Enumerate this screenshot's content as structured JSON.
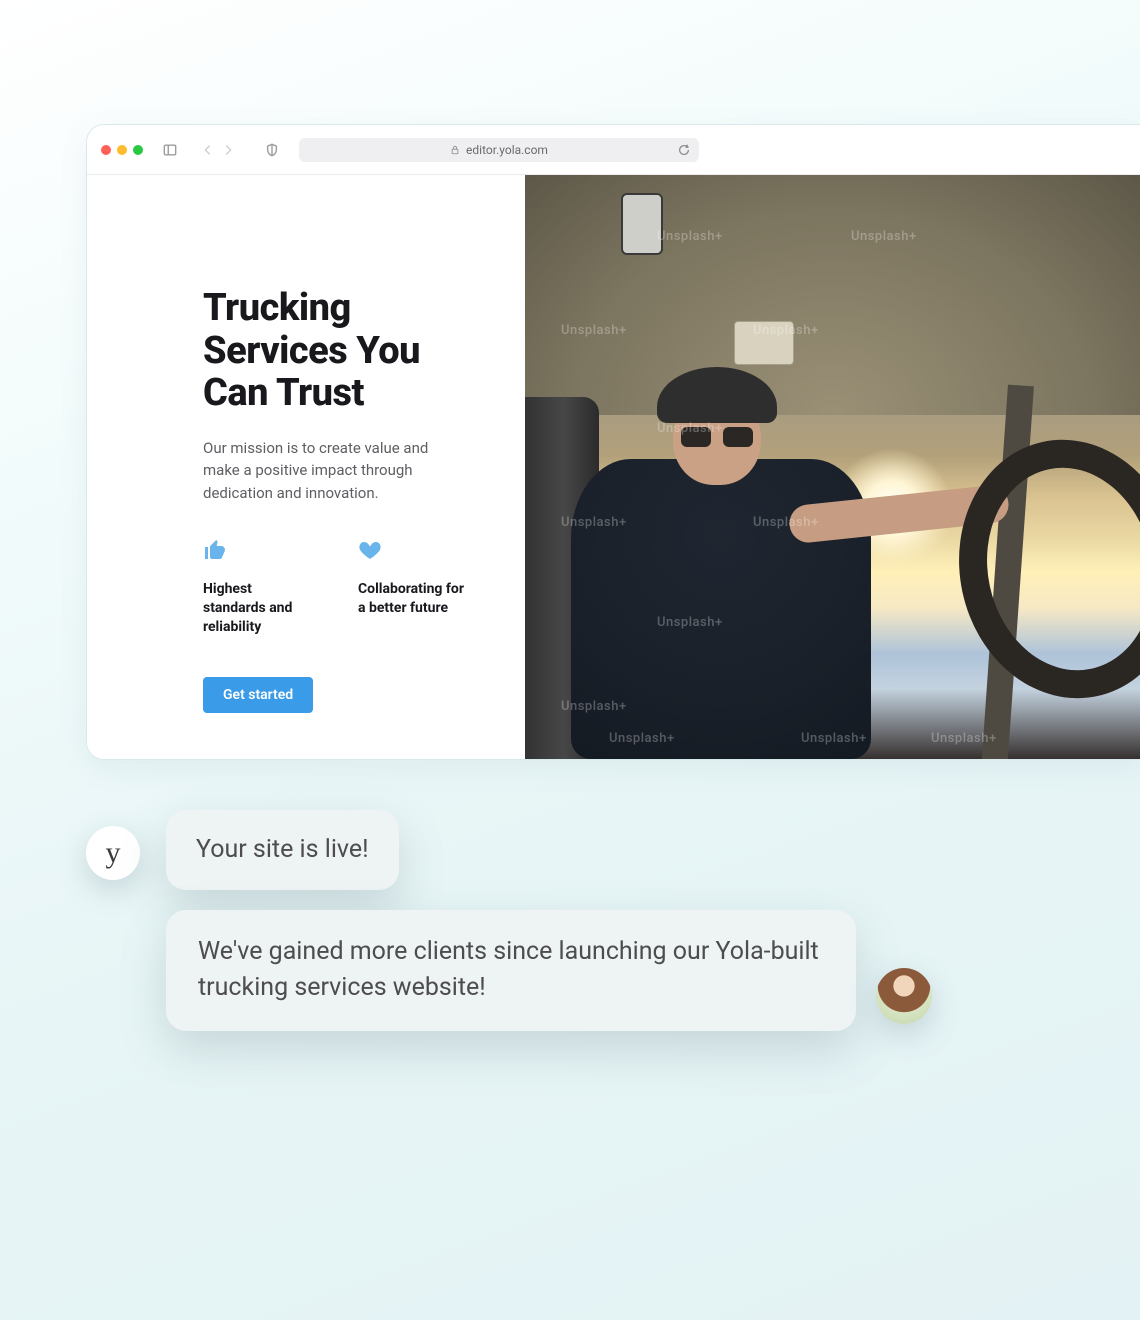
{
  "browser": {
    "url_host": "editor.yola.com",
    "url_lock": true
  },
  "hero": {
    "title": "Trucking Services You Can Trust",
    "subtitle": "Our mission is to create value and make a positive impact through dedication and innovation.",
    "features": [
      {
        "icon": "thumbs-up-icon",
        "label": "Highest standards and reliability"
      },
      {
        "icon": "heart-icon",
        "label": "Collaborating for a better future"
      }
    ],
    "cta_label": "Get started",
    "image_watermark": "Unsplash+"
  },
  "chat": {
    "brand_avatar_letter": "y",
    "bubble1": "Your site is live!",
    "bubble2": "We've gained more clients since launching our Yola-built trucking services website!"
  }
}
